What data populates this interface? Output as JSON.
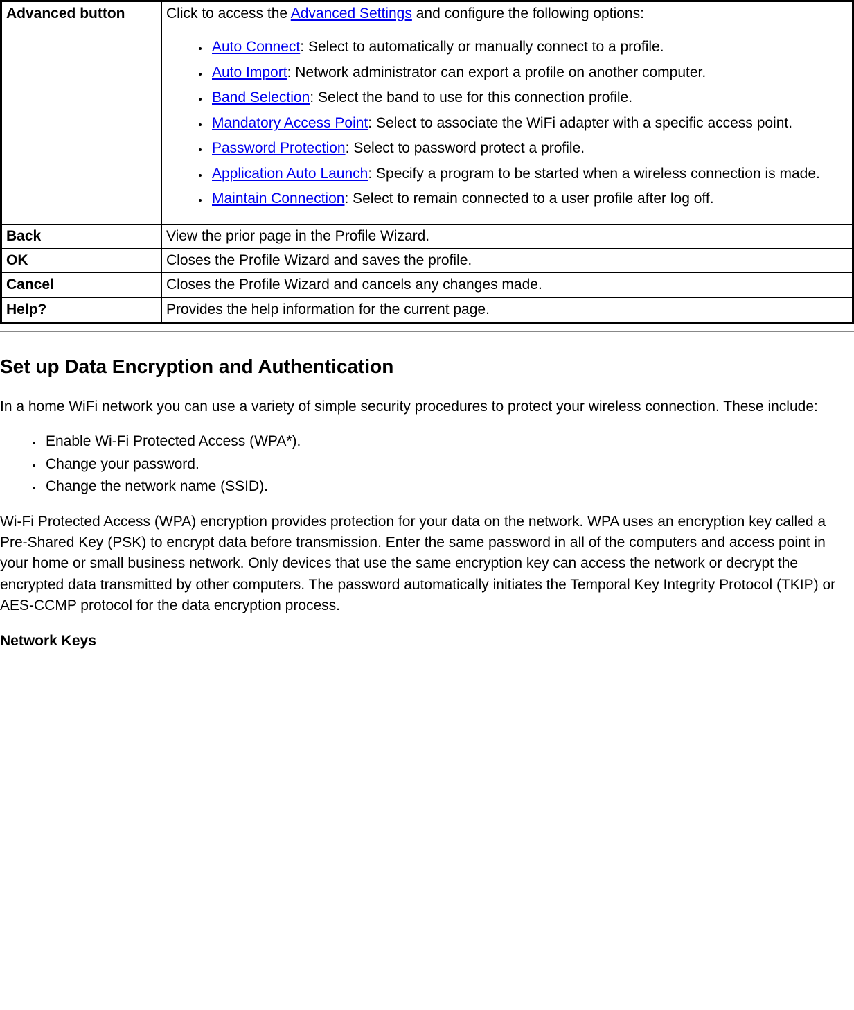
{
  "table": {
    "rows": [
      {
        "label": "Advanced button",
        "intro_prefix": "Click to access the ",
        "intro_link": "Advanced Settings",
        "intro_suffix": " and configure the following options:",
        "items": [
          {
            "link": "Auto Connect",
            "desc": ": Select to automatically or manually connect to a profile."
          },
          {
            "link": "Auto Import",
            "desc": ": Network administrator can export a profile on another computer."
          },
          {
            "link": "Band Selection",
            "desc": ": Select the band to use for this connection profile."
          },
          {
            "link": "Mandatory Access Point",
            "desc": ": Select to associate the WiFi adapter with a specific access point."
          },
          {
            "link": "Password Protection",
            "desc": ": Select to password protect a profile."
          },
          {
            "link": "Application Auto Launch",
            "desc": ": Specify a program to be started when a wireless connection is made."
          },
          {
            "link": "Maintain Connection",
            "desc": ": Select to remain connected to a user profile after log off."
          }
        ]
      },
      {
        "label": "Back",
        "desc": "View the prior page in the Profile Wizard."
      },
      {
        "label": "OK",
        "desc": "Closes the Profile Wizard and saves the profile."
      },
      {
        "label": "Cancel",
        "desc": "Closes the Profile Wizard and cancels any changes made."
      },
      {
        "label": "Help?",
        "desc": "Provides the help information for the current page."
      }
    ]
  },
  "section": {
    "heading": "Set up Data Encryption and Authentication",
    "para1": "In a home WiFi network you can use a variety of simple security procedures to protect your wireless connection. These include:",
    "bullets": [
      "Enable Wi-Fi Protected Access (WPA*).",
      "Change your password.",
      "Change the network name (SSID)."
    ],
    "para2": "Wi-Fi Protected Access (WPA) encryption provides protection for your data on the network. WPA uses an encryption key called a Pre-Shared Key (PSK) to encrypt data before transmission. Enter the same password in all of the computers and access point in your home or small business network. Only devices that use the same encryption key can access the network or decrypt the encrypted data transmitted by other computers. The password automatically initiates the Temporal Key Integrity Protocol (TKIP) or AES-CCMP protocol for the data encryption process.",
    "subheading": "Network Keys"
  }
}
